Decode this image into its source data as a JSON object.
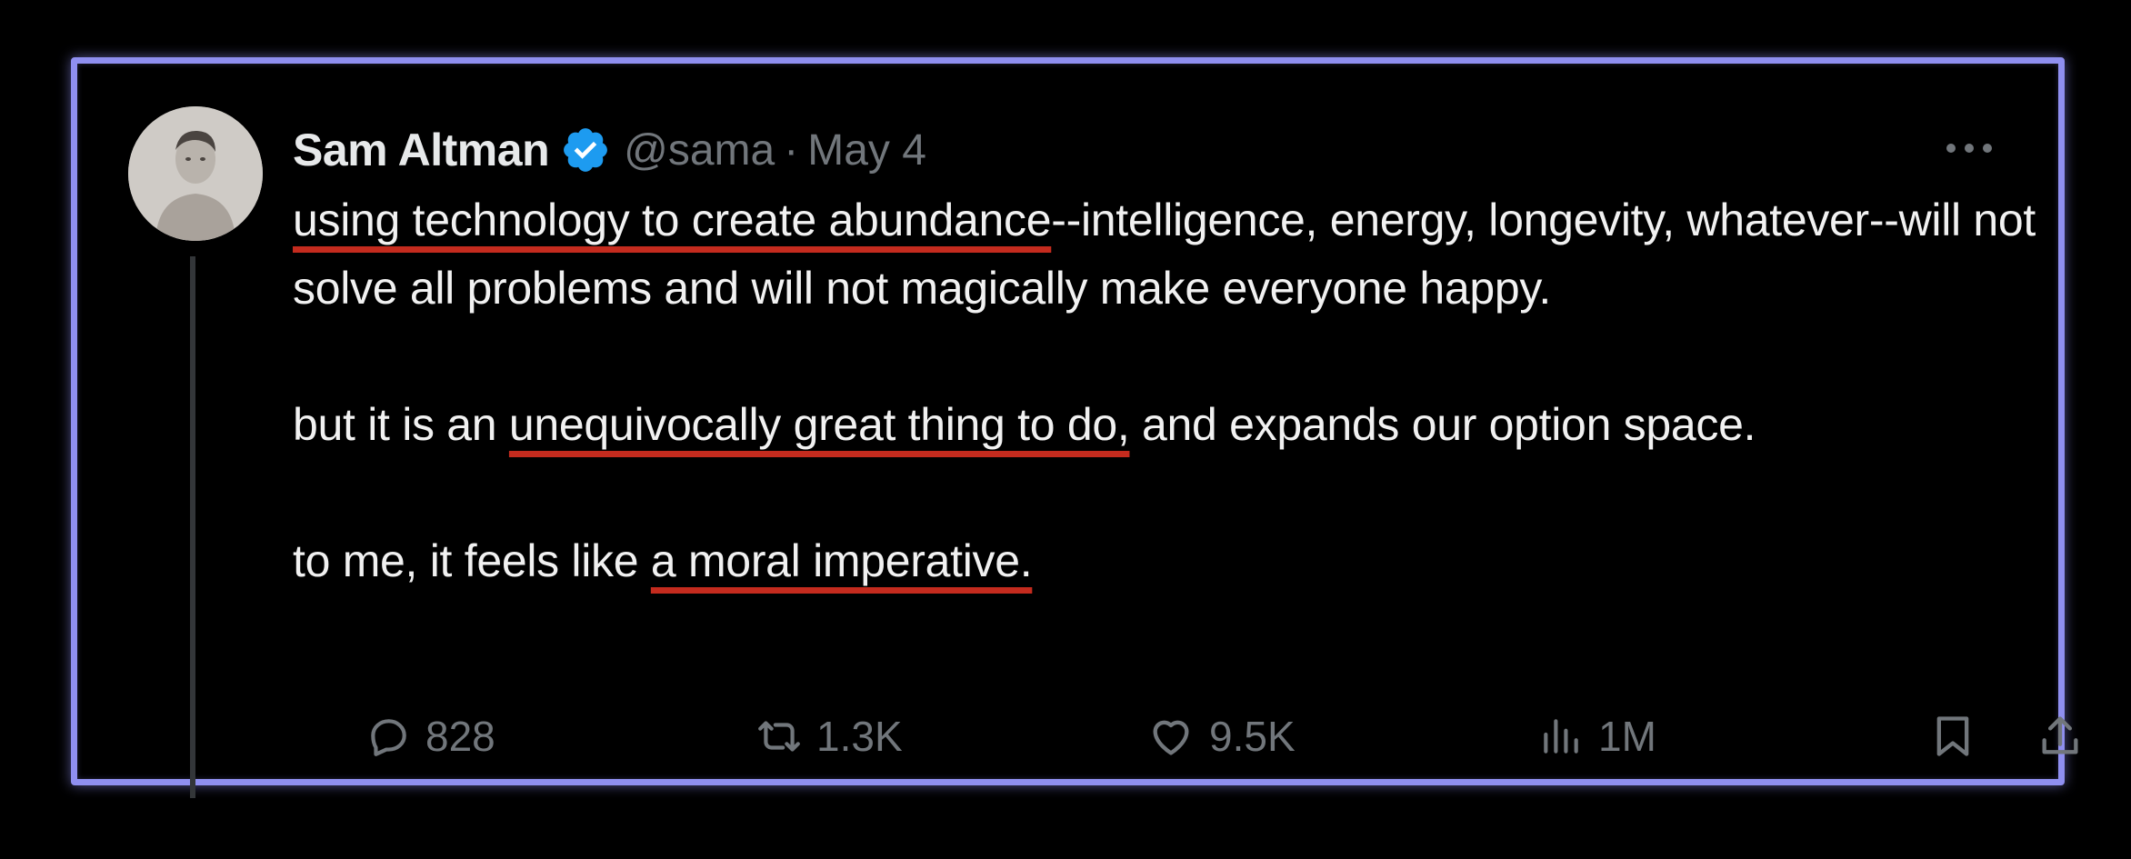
{
  "post": {
    "author_name": "Sam Altman",
    "verified": true,
    "handle": "@sama",
    "separator": "·",
    "date": "May 4",
    "accent_color": "#1d9bf0",
    "highlight_color": "#c42b1e",
    "paragraphs": [
      {
        "segments": [
          {
            "text": "using technology to create abundance",
            "highlight": true
          },
          {
            "text": "--intelligence, energy, longevity, whatever--will not solve all problems and will not magically make everyone happy.",
            "highlight": false
          }
        ]
      },
      {
        "segments": [
          {
            "text": "but it is an ",
            "highlight": false
          },
          {
            "text": "unequivocally great thing to do,",
            "highlight": true
          },
          {
            "text": " and expands our option space.",
            "highlight": false
          }
        ]
      },
      {
        "segments": [
          {
            "text": "to me, it feels like ",
            "highlight": false
          },
          {
            "text": "a moral imperative.",
            "highlight": true
          }
        ]
      }
    ],
    "stats": {
      "replies": "828",
      "reposts": "1.3K",
      "likes": "9.5K",
      "views": "1M"
    },
    "icons": {
      "reply": "reply-icon",
      "repost": "repost-icon",
      "like": "heart-icon",
      "views": "views-icon",
      "bookmark": "bookmark-icon",
      "share": "share-icon",
      "more": "more-icon",
      "verified": "verified-badge-icon"
    }
  }
}
